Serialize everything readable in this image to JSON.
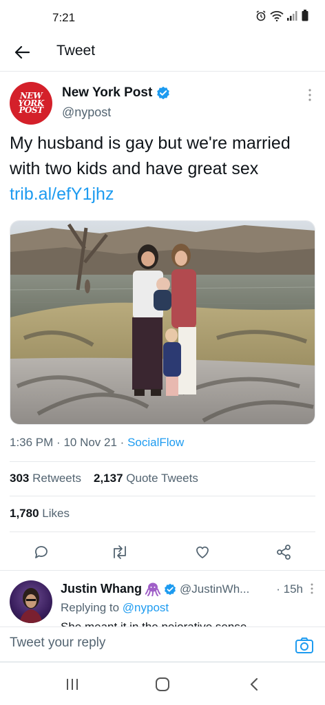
{
  "status_bar": {
    "time": "7:21",
    "icons": [
      "alarm-icon",
      "wifi-icon",
      "signal-icon",
      "battery-icon"
    ]
  },
  "header": {
    "title": "Tweet",
    "back_icon": "arrow-left-icon"
  },
  "tweet": {
    "author_name": "New York Post",
    "author_handle": "@nypost",
    "verified": true,
    "avatar_text": [
      "NEW",
      "YORK",
      "POST"
    ],
    "text": "My husband is gay but we're married with two kids and have great sex ",
    "link": "trib.al/efY1jhz",
    "time": "1:36 PM",
    "date": "10 Nov 21",
    "source": "SocialFlow",
    "retweets_count": "303",
    "retweets_label": "Retweets",
    "quotes_count": "2,137",
    "quotes_label": "Quote Tweets",
    "likes_count": "1,780",
    "likes_label": "Likes"
  },
  "actions": [
    "reply-icon",
    "retweet-icon",
    "like-icon",
    "share-icon"
  ],
  "reply": {
    "name": "Justin Whang",
    "handle": "@JustinWh...",
    "time": "15h",
    "replying_to_label": "Replying to",
    "replying_to_handle": "@nypost",
    "body": "She meant it in the pejorative sense"
  },
  "composer": {
    "placeholder": "Tweet your reply"
  },
  "colors": {
    "accent": "#1d9bf0",
    "nyp_red": "#d4202a",
    "text_primary": "#0f1419",
    "text_secondary": "#536471"
  }
}
